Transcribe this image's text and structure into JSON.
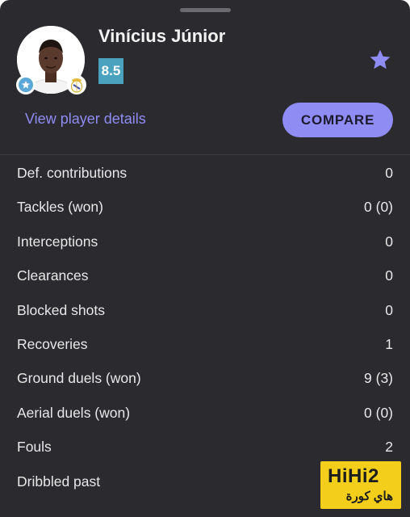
{
  "player": {
    "name": "Vinícius Júnior",
    "rating": "8.5",
    "rating_color": "#4aa2be"
  },
  "actions": {
    "view_details": "View player details",
    "compare": "COMPARE"
  },
  "icons": {
    "favorite": "star-icon",
    "position_badge": "star-badge-icon",
    "club_badge": "club-crest-icon"
  },
  "theme": {
    "background": "#2b2b2f",
    "accent": "#8f8cf4"
  },
  "stats": [
    {
      "label": "Def. contributions",
      "value": "0"
    },
    {
      "label": "Tackles (won)",
      "value": "0 (0)"
    },
    {
      "label": "Interceptions",
      "value": "0"
    },
    {
      "label": "Clearances",
      "value": "0"
    },
    {
      "label": "Blocked shots",
      "value": "0"
    },
    {
      "label": "Recoveries",
      "value": "1"
    },
    {
      "label": "Ground duels (won)",
      "value": "9 (3)"
    },
    {
      "label": "Aerial duels (won)",
      "value": "0 (0)"
    },
    {
      "label": "Fouls",
      "value": "2"
    },
    {
      "label": "Dribbled past",
      "value": ""
    }
  ],
  "watermark": {
    "top": "HiHi2",
    "bottom": "هاي كورة"
  }
}
